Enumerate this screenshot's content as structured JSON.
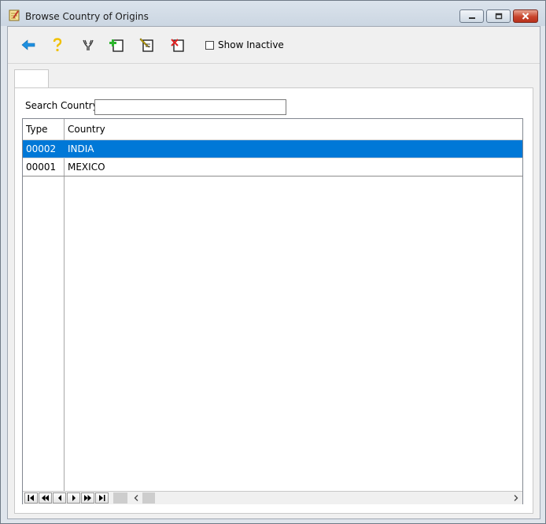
{
  "window": {
    "title": "Browse Country of Origins"
  },
  "toolbar": {
    "show_inactive_label": "Show Inactive",
    "show_inactive_checked": false,
    "icons": [
      "back-arrow-icon",
      "help-icon",
      "filter-icon",
      "add-record-icon",
      "edit-record-icon",
      "delete-record-icon"
    ]
  },
  "search": {
    "label": "Search Country",
    "value": ""
  },
  "grid": {
    "columns": [
      "Type",
      "Country"
    ],
    "rows": [
      {
        "type": "00002",
        "country": "INDIA",
        "selected": true
      },
      {
        "type": "00001",
        "country": "MEXICO",
        "selected": false
      }
    ]
  },
  "colors": {
    "selection": "#0078d7",
    "close_button": "#c8452d"
  }
}
